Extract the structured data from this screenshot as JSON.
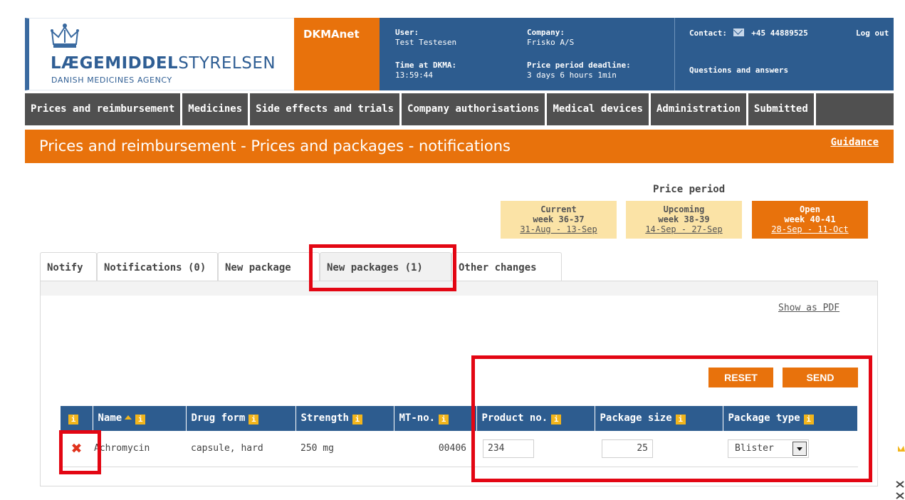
{
  "header": {
    "logo_name_bold": "LÆGEMIDDEL",
    "logo_name_light": "STYRELSEN",
    "logo_sub": "DANISH MEDICINES AGENCY",
    "app_name": "DKMAnet",
    "user_label": "User:",
    "user_value": "Test Testesen",
    "company_label": "Company:",
    "company_value": "Frisko A/S",
    "time_label": "Time at DKMA:",
    "time_value": "13:59:44",
    "deadline_label": "Price period deadline:",
    "deadline_value": "3 days 6 hours 1min",
    "contact_label": "Contact:",
    "contact_phone": "+45 44889525",
    "logout": "Log out",
    "questions": "Questions and answers"
  },
  "nav": {
    "items": [
      "Prices and reimbursement",
      "Medicines",
      "Side effects and trials",
      "Company authorisations",
      "Medical devices",
      "Administration",
      "Submitted"
    ]
  },
  "title_bar": {
    "title": "Prices and reimbursement - Prices and packages - notifications",
    "guidance": "Guidance"
  },
  "price_period": {
    "title": "Price period",
    "periods": [
      {
        "label": "Current",
        "week": "week 36-37",
        "dates": "31-Aug - 13-Sep"
      },
      {
        "label": "Upcoming",
        "week": "week 38-39",
        "dates": "14-Sep - 27-Sep"
      },
      {
        "label": "Open",
        "week": "week 40-41",
        "dates": "28-Sep - 11-Oct"
      }
    ]
  },
  "tabs": [
    "Notify",
    "Notifications (0)",
    "New package",
    "New packages (1)",
    "Other changes"
  ],
  "content": {
    "show_pdf": "Show as PDF",
    "reset": "RESET",
    "send": "SEND"
  },
  "table": {
    "headers": {
      "info": "i",
      "name": "Name",
      "drug_form": "Drug form",
      "strength": "Strength",
      "mt_no": "MT-no.",
      "product_no": "Product no.",
      "package_size": "Package size",
      "package_type": "Package type"
    },
    "row": {
      "name": "Achromycin",
      "drug_form": "capsule, hard",
      "strength": "250 mg",
      "mt_no": "00406",
      "product_no": "234",
      "package_size": "25",
      "package_type": "Blister"
    }
  },
  "colors": {
    "orange": "#e8720c",
    "blue": "#2d5c8f",
    "nav_grey": "#505050",
    "highlight_red": "#e30613"
  }
}
